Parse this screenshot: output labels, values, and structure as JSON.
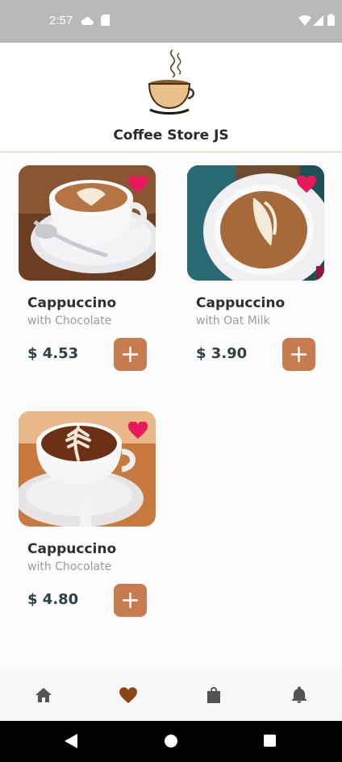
{
  "status_bar": {
    "time": "2:57",
    "icons": [
      "cloud-icon",
      "sd-card-icon",
      "wifi-icon",
      "signal-icon",
      "battery-icon"
    ]
  },
  "header": {
    "title": "Coffee Store JS",
    "logo": "coffee-cup-logo"
  },
  "products": [
    {
      "name": "Cappuccino",
      "subtitle": "with Chocolate",
      "price": "$ 4.53",
      "favorite": true
    },
    {
      "name": "Cappuccino",
      "subtitle": "with Oat Milk",
      "price": "$ 3.90",
      "favorite": true
    },
    {
      "name": "Cappuccino",
      "subtitle": "with Chocolate",
      "price": "$ 4.80",
      "favorite": true
    }
  ],
  "bottom_nav": {
    "items": [
      "home-icon",
      "heart-icon",
      "shopping-bag-icon",
      "bell-icon"
    ],
    "active": "heart-icon"
  },
  "colors": {
    "accent": "#c67c4e",
    "active_nav": "#8b4513",
    "favorite": "#e8195a",
    "price": "#2f4047"
  }
}
